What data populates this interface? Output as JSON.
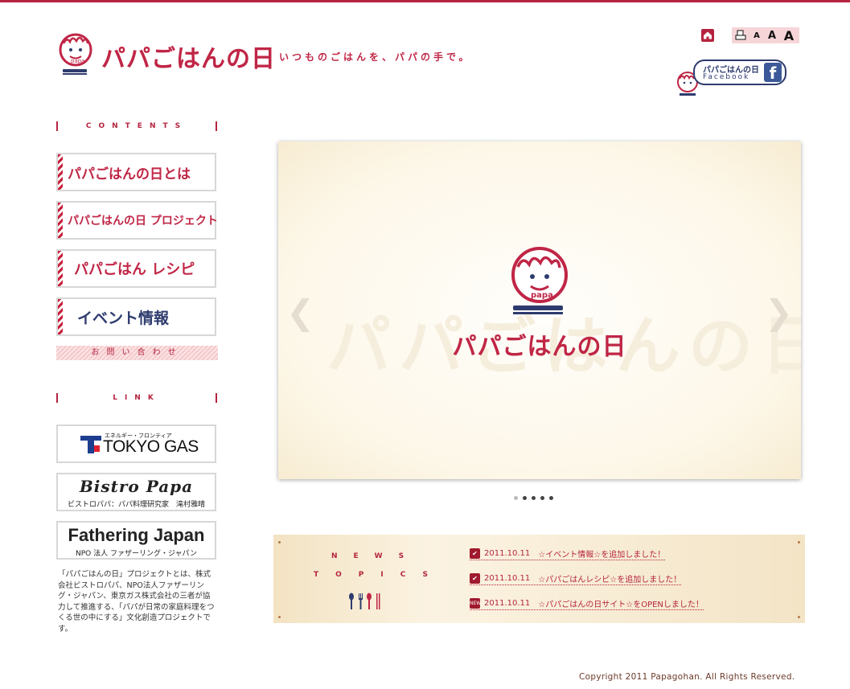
{
  "header": {
    "logo_text": "パパごはんの日",
    "logo_badge": "papa",
    "tagline": "いつものごはんを、パパの手で。"
  },
  "tools": {
    "home_icon": "home-icon",
    "print_icon": "printer-icon",
    "font_small": "A",
    "font_medium": "A",
    "font_large": "A"
  },
  "facebook": {
    "title": "パパごはんの日",
    "subtitle": "Facebook",
    "icon_letter": "f"
  },
  "sidebar": {
    "contents_heading": "CONTENTS",
    "menu": [
      {
        "label": "パパごはんの日とは"
      },
      {
        "label": "パパごはんの日 プロジェクト"
      },
      {
        "label": "パパごはん レシピ"
      },
      {
        "label": "イベント情報"
      }
    ],
    "contact_label": "お問い合わせ",
    "link_heading": "LINK",
    "links": {
      "tokyo_gas_small": "エネルギー・フロンティア",
      "tokyo_gas_name": "TOKYO GAS",
      "bistro_name": "Bistro Papa",
      "bistro_sub": "ビストロパパ：パパ料理研究家　滝村雅晴",
      "fj_name": "Fathering Japan",
      "fj_sub": "NPO 法人 ファザーリング・ジャパン"
    },
    "about": "「パパごはんの日」プロジェクトとは、株式会社ビストロパパ、NPO法人ファザーリング・ジャパン、東京ガス株式会社の三者が協力して推進する、「パパが日常の家庭料理をつくる世の中にする」文化創造プロジェクトです。"
  },
  "slider": {
    "slide_logo_text": "パパごはんの日",
    "slide_badge": "papa",
    "prev_icon": "chevron-left-icon",
    "next_icon": "chevron-right-icon",
    "slide_count": 5,
    "active_slide": 1
  },
  "news": {
    "heading_line1": "NEWS",
    "heading_line2": "TOPICS",
    "items": [
      {
        "icon": "check",
        "icon_text": "✔",
        "date": "2011.10.11",
        "text": "☆イベント情報☆を追加しました！"
      },
      {
        "icon": "check",
        "icon_text": "✔",
        "date": "2011.10.11",
        "text": "☆パパごはんレシピ☆を追加しました！"
      },
      {
        "icon": "new",
        "icon_text": "NEW",
        "date": "2011.10.11",
        "text": "☆パパごはんの日サイト☆をOPENしました！"
      }
    ]
  },
  "footer": {
    "copyright": "Copyright 2011 Papagohan. All Rights Reserved."
  },
  "colors": {
    "brand_red": "#c02646",
    "brand_navy": "#2e3b6e",
    "news_bg": "#f3e3c3"
  }
}
